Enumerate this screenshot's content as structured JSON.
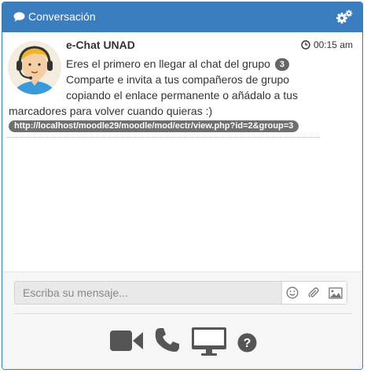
{
  "header": {
    "title": "Conversación",
    "icon": "comment-icon",
    "settings_icon": "gears-icon",
    "color": "#3b7ec0"
  },
  "message": {
    "sender": "e-Chat UNAD",
    "time": "00:15 am",
    "line1": "Eres el primero en llegar al chat del grupo",
    "group_badge": "3",
    "line2": "Comparte e invita a tus compañeros de grupo",
    "line3": "copiando el enlace permanente o añádalo a tus",
    "line4": "marcadores para volver cuando quieras :)",
    "link": "http://localhost/moodle29/moodle/mod/ectr/view.php?id=2&group=3"
  },
  "composer": {
    "placeholder": "Escriba su mensaje...",
    "icons": [
      "smile-icon",
      "paperclip-icon",
      "image-icon"
    ]
  },
  "actions": [
    "video-camera-icon",
    "phone-icon",
    "desktop-icon",
    "help-icon"
  ]
}
